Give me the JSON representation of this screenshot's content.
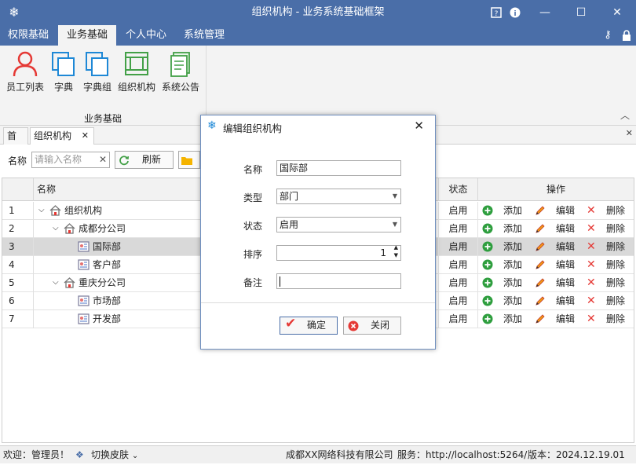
{
  "window": {
    "title": "组织机构 - 业务系统基础框架"
  },
  "menu": {
    "tabs": [
      "权限基础",
      "业务基础",
      "个人中心",
      "系统管理"
    ]
  },
  "ribbon": {
    "buttons": [
      "员工列表",
      "字典",
      "字典组",
      "组织机构",
      "系统公告"
    ],
    "group_label": "业务基础"
  },
  "doc_tabs": {
    "home": "首页",
    "current": "组织机构"
  },
  "toolbar": {
    "name_label": "名称",
    "search_placeholder": "请输入名称",
    "refresh_label": "刷新"
  },
  "grid": {
    "headers": {
      "name": "名称",
      "status": "状态",
      "actions": "操作"
    },
    "rows": [
      {
        "num": "1",
        "name": "组织机构",
        "status": "启用"
      },
      {
        "num": "2",
        "name": "成都分公司",
        "status": "启用"
      },
      {
        "num": "3",
        "name": "国际部",
        "status": "启用"
      },
      {
        "num": "4",
        "name": "客户部",
        "status": "启用"
      },
      {
        "num": "5",
        "name": "重庆分公司",
        "status": "启用"
      },
      {
        "num": "6",
        "name": "市场部",
        "status": "启用"
      },
      {
        "num": "7",
        "name": "开发部",
        "status": "启用"
      }
    ],
    "action_labels": {
      "add": "添加",
      "edit": "编辑",
      "delete": "删除"
    }
  },
  "dialog": {
    "title": "编辑组织机构",
    "name_label": "名称",
    "name_value": "国际部",
    "type_label": "类型",
    "type_value": "部门",
    "status_label": "状态",
    "status_value": "启用",
    "order_label": "排序",
    "order_value": "1",
    "remark_label": "备注",
    "remark_value": "",
    "ok_label": "确定",
    "close_label": "关闭"
  },
  "statusbar": {
    "welcome": "欢迎：管理员！",
    "skin": "切换皮肤",
    "company": "成都XX网络科技有限公司",
    "service": "服务：http://localhost:5264/",
    "version": "版本：2024.12.19.01"
  },
  "colors": {
    "title_bar": "#4a6ea8",
    "ribbon_bg": "#f3f3f3",
    "selected_row": "#d9d9d9",
    "icon_blue": "#1e88d6"
  }
}
